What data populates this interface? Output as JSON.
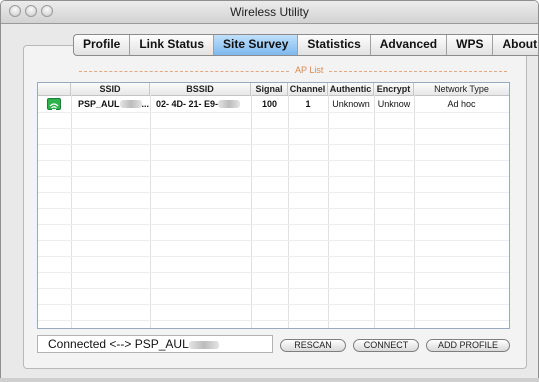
{
  "window": {
    "title": "Wireless Utility"
  },
  "tabs": [
    {
      "label": "Profile",
      "active": false
    },
    {
      "label": "Link Status",
      "active": false
    },
    {
      "label": "Site Survey",
      "active": true
    },
    {
      "label": "Statistics",
      "active": false
    },
    {
      "label": "Advanced",
      "active": false
    },
    {
      "label": "WPS",
      "active": false
    },
    {
      "label": "About",
      "active": false
    }
  ],
  "ap_list": {
    "label": "AP List",
    "columns": [
      "SSID",
      "BSSID",
      "Signal",
      "Channel",
      "Authentic",
      "Encrypt",
      "Network Type"
    ],
    "rows": [
      {
        "icon": "access-point-icon",
        "ssid": "PSP_AUL",
        "ssid_suffix": "...",
        "bssid": "02- 4D- 21- E9-",
        "signal": "100",
        "channel": "1",
        "auth": "Unknown",
        "encrypt": "Unknow",
        "network_type": "Ad  hoc"
      }
    ]
  },
  "status": {
    "text": "Connected <--> PSP_AUL"
  },
  "buttons": {
    "rescan": "RESCAN",
    "connect": "CONNECT",
    "add_profile": "ADD PROFILE"
  },
  "colors": {
    "active_tab": "#8fc3f1",
    "aplist_label": "#d98a4f",
    "icon_green": "#2fb14b"
  }
}
